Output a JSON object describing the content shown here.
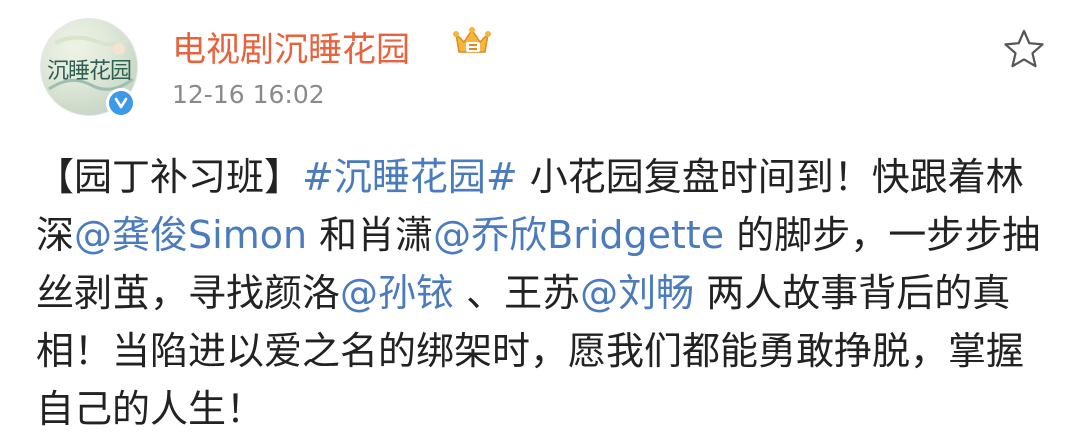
{
  "user": {
    "avatar_text": "沉睡花园",
    "name": "电视剧沉睡花园",
    "timestamp": "12-16 16:02"
  },
  "icons": {
    "avatar": "avatar-image",
    "verified": "verified-badge-icon",
    "vip": "crown-icon",
    "favorite": "star-icon"
  },
  "colors": {
    "username": "#e8623b",
    "link": "#4a7bbf",
    "timestamp": "#8a8a8a",
    "text": "#222222"
  },
  "post": {
    "p1": "【园丁补习班】",
    "hashtag": "#沉睡花园#",
    "p2": " 小花园复盘时间到！快跟着林深",
    "mention1": "@龚俊Simon",
    "p3": " 和肖潇",
    "mention2": "@乔欣Bridgette",
    "p4": " 的脚步，一步步抽丝剥茧，寻找颜洛",
    "mention3": "@孙铱",
    "p5": " 、王苏",
    "mention4": "@刘畅",
    "p6": " 两人故事背后的真相！当陷进以爱之名的绑架时，愿我们都能勇敢挣脱，掌握自己的人生！"
  }
}
